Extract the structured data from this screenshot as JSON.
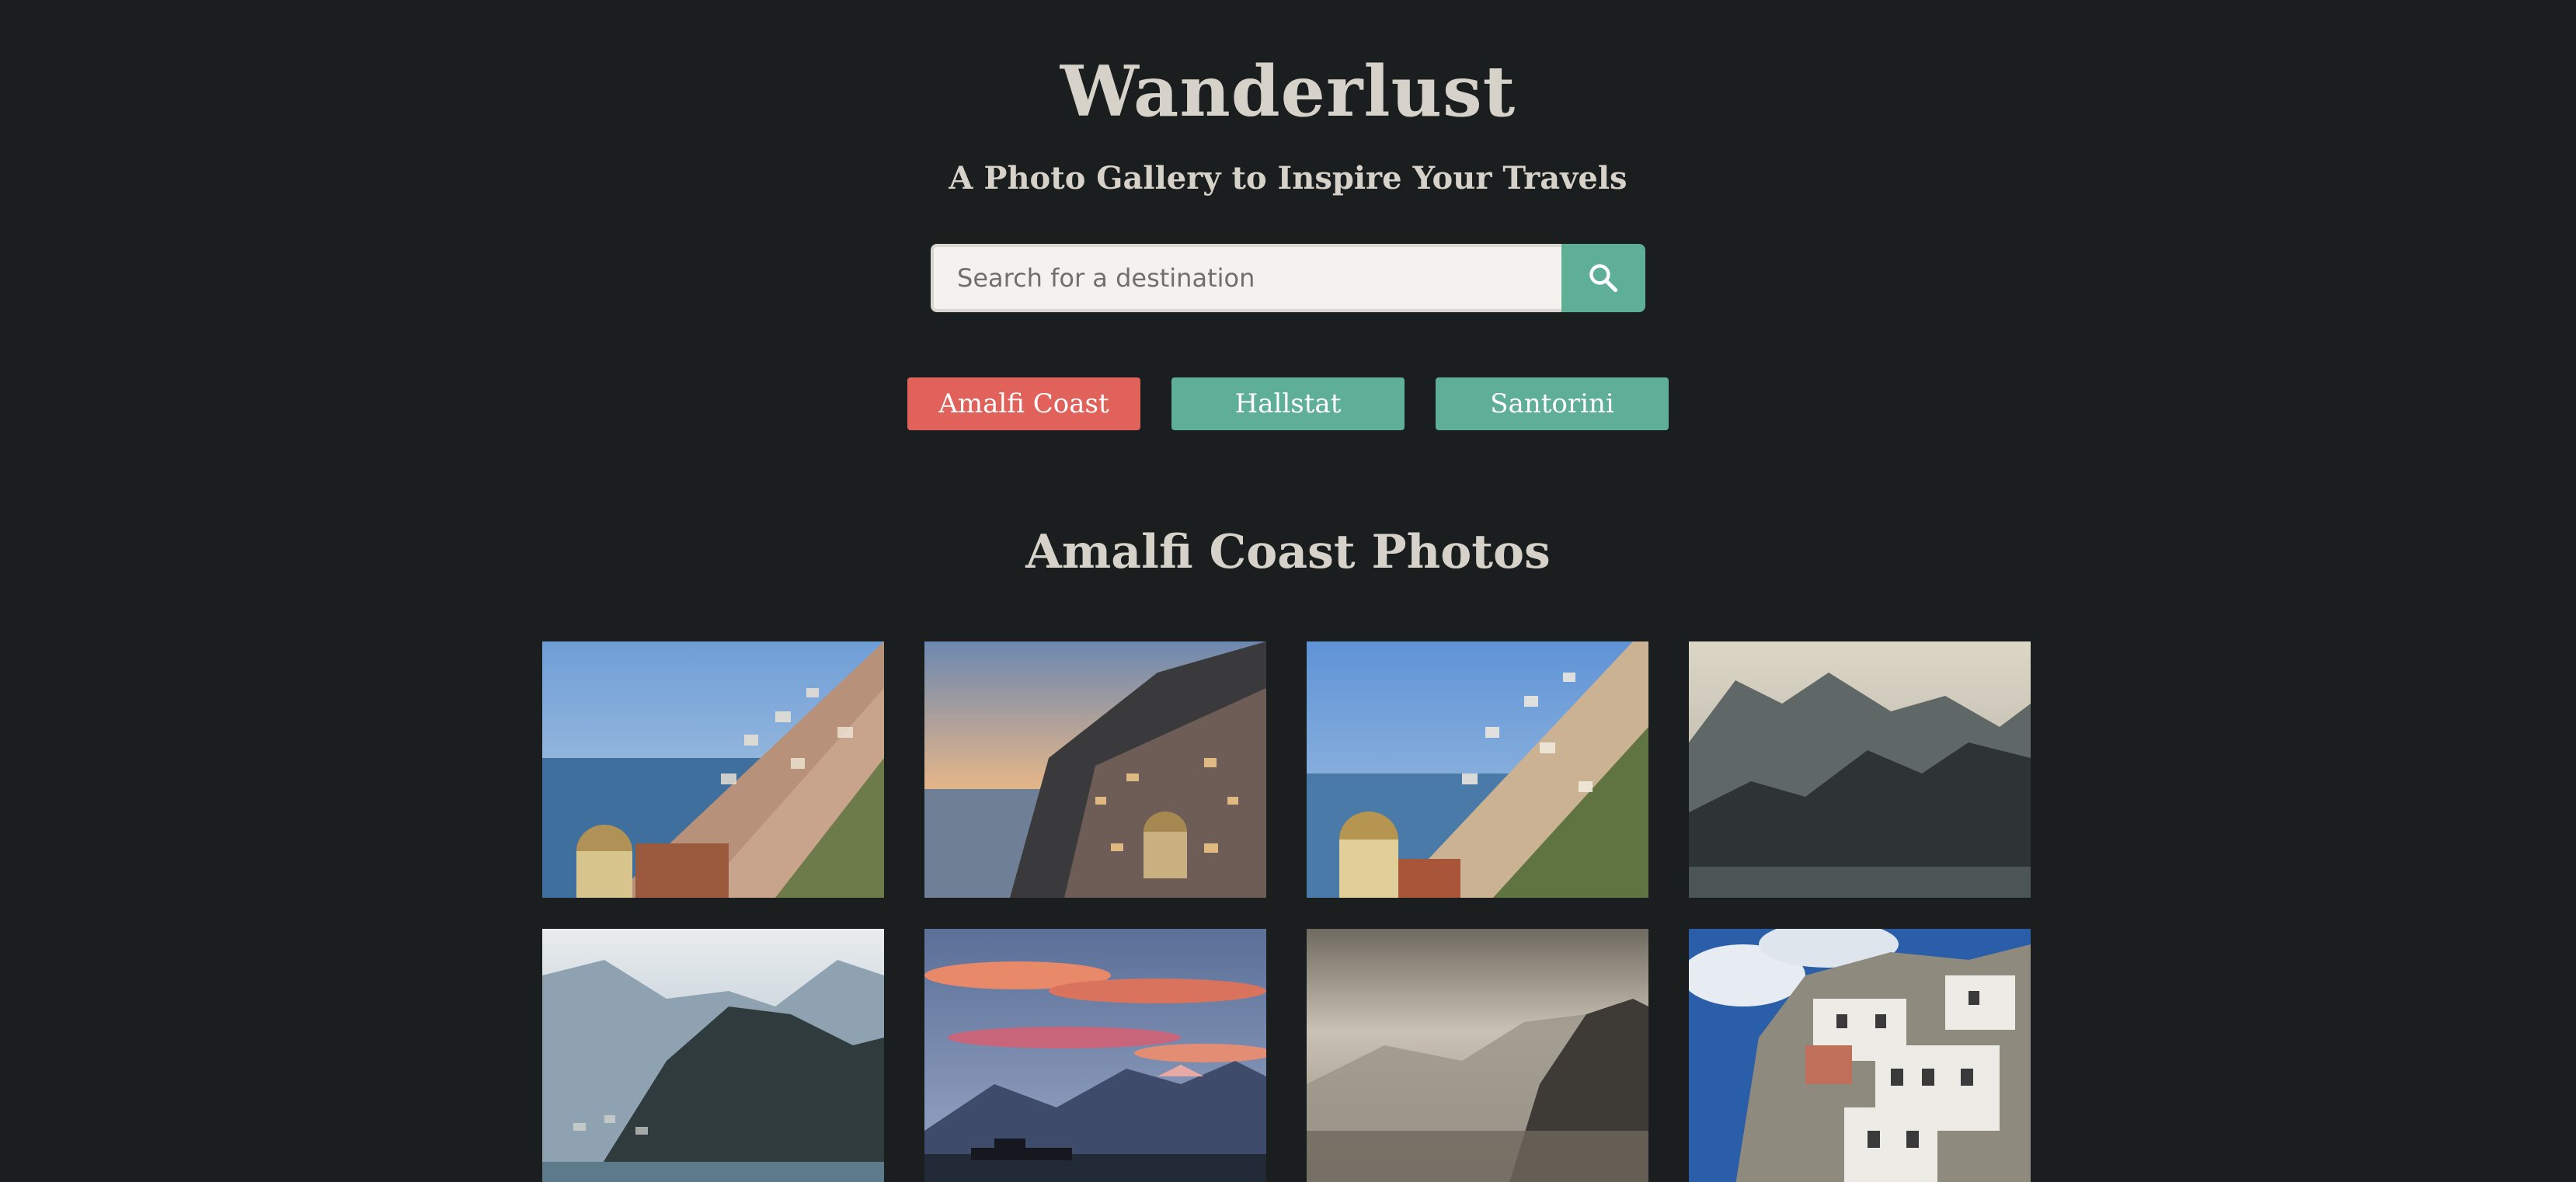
{
  "header": {
    "title": "Wanderlust",
    "subtitle": "A Photo Gallery to Inspire Your Travels"
  },
  "search": {
    "placeholder": "Search for a destination",
    "value": "",
    "button_icon": "search-icon"
  },
  "destinations": [
    {
      "label": "Amalfi Coast",
      "active": true
    },
    {
      "label": "Hallstat",
      "active": false
    },
    {
      "label": "Santorini",
      "active": false
    }
  ],
  "gallery": {
    "heading": "Amalfi Coast Photos",
    "photos": [
      {
        "subject": "Positano hillside village with domed church by the sea"
      },
      {
        "subject": "Positano village at sunset"
      },
      {
        "subject": "Positano hillside with domed church in daylight"
      },
      {
        "subject": "Misty mountain ridges over the sea"
      },
      {
        "subject": "Hazy coastal cliffs with village"
      },
      {
        "subject": "Pink sunset clouds over mountains and a ship"
      },
      {
        "subject": "Sepia foggy coastal cliffs"
      },
      {
        "subject": "White cliffside houses under blue sky"
      }
    ]
  },
  "colors": {
    "background": "#1b1e1f",
    "accent": "#5fae96",
    "active_tag": "#e0625a",
    "text": "#d6d2ca"
  }
}
